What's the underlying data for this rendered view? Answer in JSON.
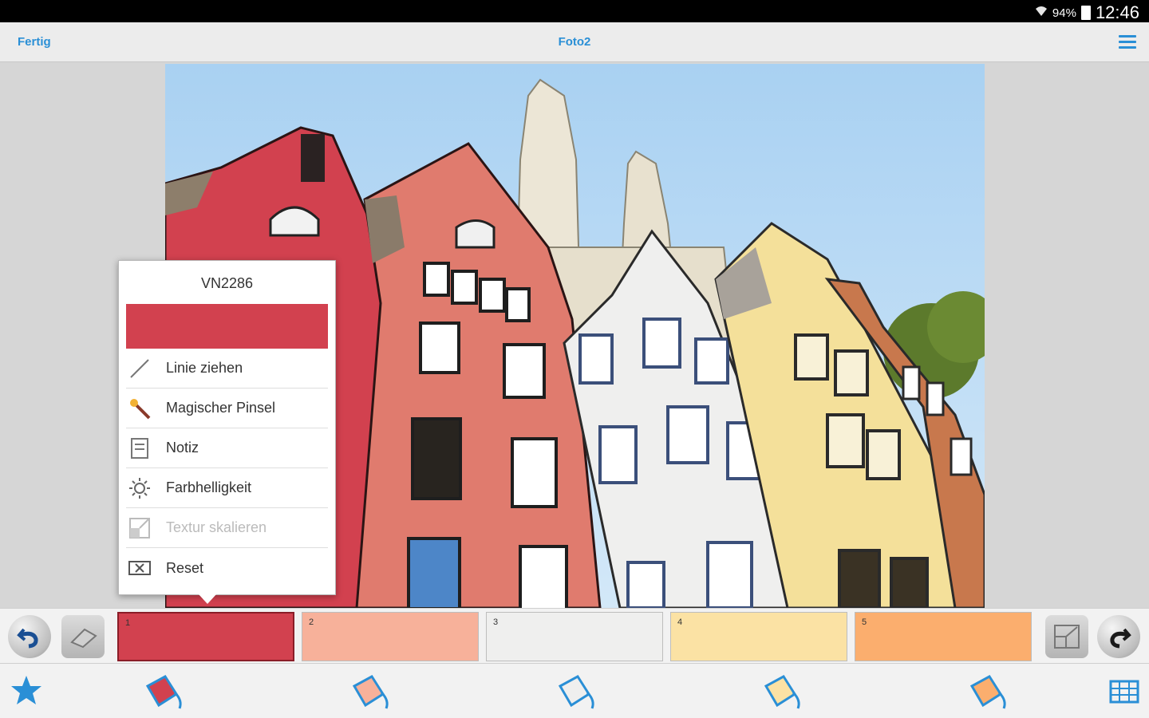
{
  "status_bar": {
    "battery_percent": "94%",
    "time": "12:46"
  },
  "app_bar": {
    "done_label": "Fertig",
    "title": "Foto2"
  },
  "popup": {
    "color_code": "VN2286",
    "swatch_color": "#d2414f",
    "menu_items": [
      {
        "label": "Linie ziehen",
        "icon": "line-icon",
        "enabled": true
      },
      {
        "label": "Magischer Pinsel",
        "icon": "magic-wand-icon",
        "enabled": true
      },
      {
        "label": "Notiz",
        "icon": "note-icon",
        "enabled": true
      },
      {
        "label": "Farbhelligkeit",
        "icon": "brightness-icon",
        "enabled": true
      },
      {
        "label": "Textur skalieren",
        "icon": "scale-texture-icon",
        "enabled": false
      },
      {
        "label": "Reset",
        "icon": "reset-icon",
        "enabled": true
      }
    ]
  },
  "palette": {
    "slots": [
      {
        "number": "1",
        "color": "#d2414f",
        "selected": true
      },
      {
        "number": "2",
        "color": "#f7b19a",
        "selected": false
      },
      {
        "number": "3",
        "color": "#efefee",
        "selected": false
      },
      {
        "number": "4",
        "color": "#fbe2a4",
        "selected": false
      },
      {
        "number": "5",
        "color": "#fbae6e",
        "selected": false
      }
    ]
  },
  "colors": {
    "accent": "#2a8fd6"
  }
}
